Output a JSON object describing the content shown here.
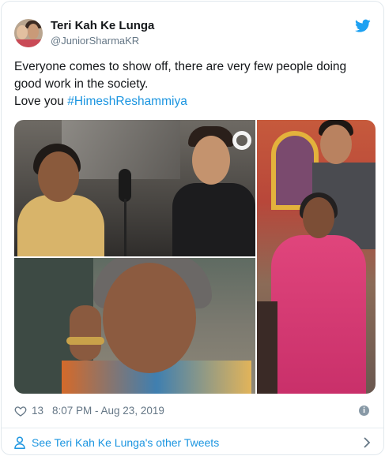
{
  "tweet": {
    "display_name": "Teri Kah Ke Lunga",
    "handle": "@JuniorSharmaKR",
    "text_line1": "Everyone comes to show off, there are very few people doing",
    "text_line2": "good work in the society.",
    "text_line3_prefix": "Love you ",
    "hashtag": "#HimeshReshammiya",
    "likes": "13",
    "timestamp": "8:07 PM - Aug 23, 2019"
  },
  "footer": {
    "other_tweets_label": "See Teri Kah Ke Lunga's other Tweets"
  },
  "icons": {
    "brand": "twitter-bird-icon",
    "like": "heart-icon",
    "info": "info-icon",
    "profile": "person-icon",
    "chevron": "chevron-right-icon"
  },
  "colors": {
    "link": "#1b95e0",
    "secondary_text": "#657786",
    "primary_text": "#14171a",
    "border": "#e1e8ed"
  }
}
